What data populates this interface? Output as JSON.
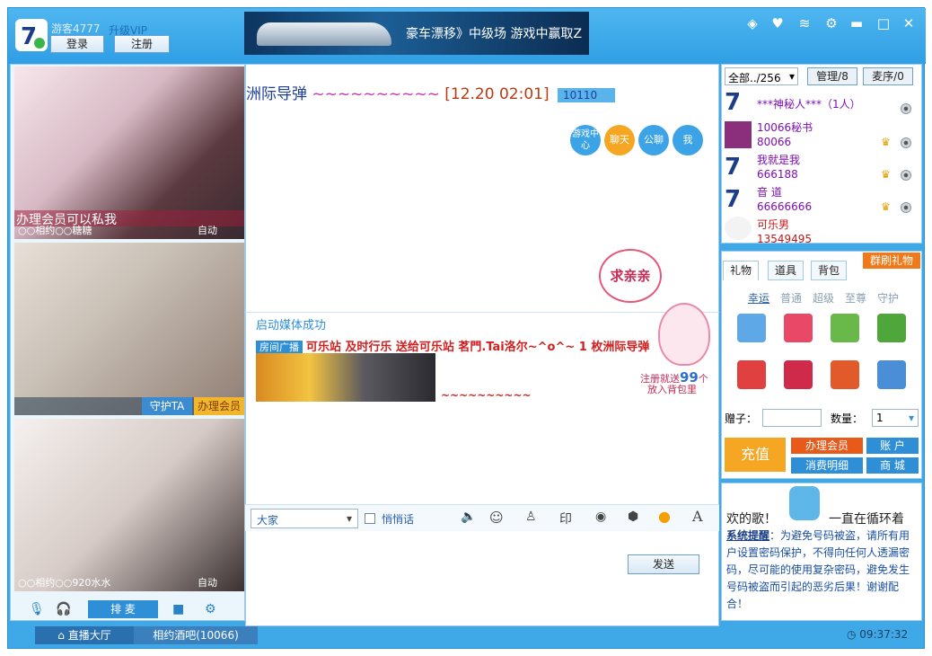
{
  "user": {
    "name": "游客4777",
    "upgrade": "升级VIP",
    "login": "登录",
    "register": "注册"
  },
  "banner": {
    "text": "豪车漂移》中级场 游戏中赢取Z"
  },
  "room": {
    "title": "洲际导弹",
    "tilde": "~~~~~~~~~~",
    "time": "[12.20 02:01]",
    "id": "10110"
  },
  "chat_buttons": [
    "游戏中心",
    "聊天",
    "公聊",
    "我"
  ],
  "videos": [
    {
      "label": "○○相约○○糖糖",
      "auto": "自动",
      "overlay": "办理会员可以私我"
    },
    {
      "guard": "守护TA",
      "vip": "办理会员"
    },
    {
      "label": "○○相约○○920水水",
      "auto": "自动"
    }
  ],
  "left_toolbar": {
    "queue": "排 麦"
  },
  "messages": {
    "system": "启动媒体成功",
    "broadcast_tag": "房间广播",
    "broadcast_text": "可乐站 及时行乐 送给可乐站 茗門.Tai洛尔~^o^~ 1 枚洲际导弹",
    "tail": "~~~~~~~~~~"
  },
  "promo": {
    "bubble": "求亲亲",
    "line1": "注册就送",
    "count": "99",
    "unit": "个",
    "line2": "放入背包里"
  },
  "input": {
    "target": "大家",
    "whisper": "悄悄话",
    "send": "发送"
  },
  "userlist": {
    "filter": "全部../256",
    "admin": "管理/8",
    "queue": "麦序/0",
    "users": [
      {
        "name": "***神秘人***（1人）"
      },
      {
        "name": "10066秘书",
        "id": "80066"
      },
      {
        "name": "我就是我",
        "id": "666188"
      },
      {
        "name": "音 道",
        "id": "66666666"
      },
      {
        "name": "可乐男",
        "id": "13549495"
      }
    ]
  },
  "gifts": {
    "tabs": [
      "礼物",
      "道具",
      "背包"
    ],
    "group": "群刷礼物",
    "cats": [
      "幸运",
      "普通",
      "超级",
      "至尊",
      "守护"
    ],
    "give_to": "赠子：",
    "qty_label": "数量：",
    "qty": "1",
    "recharge": "充值",
    "vip": "办理会员",
    "account": "账 户",
    "detail": "消费明细",
    "mall": "商 城"
  },
  "notice": {
    "song": "欢的歌！",
    "loop": "一直在循环着",
    "title": "系统提醒",
    "body": "：为避免号码被盗，请所有用户设置密码保护，不得向任何人透漏密码，尽可能的使用复杂密码，避免发生号码被盗而引起的恶劣后果！谢谢配合！"
  },
  "status": {
    "hall": "直播大厅",
    "room": "相约酒吧(10066)",
    "clock": "09:37:32"
  }
}
